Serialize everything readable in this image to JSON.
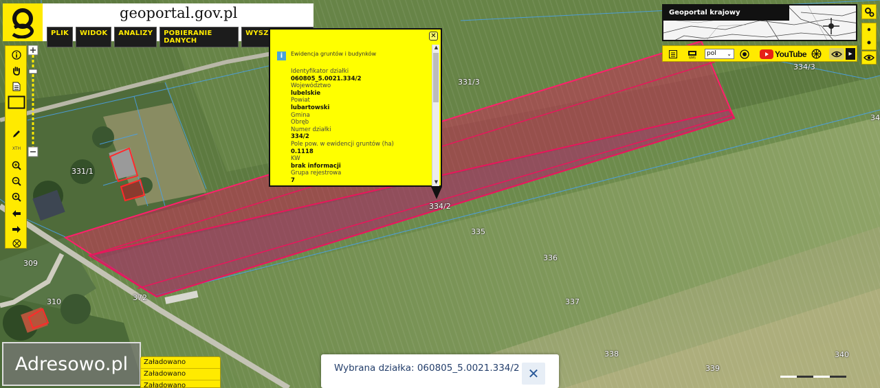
{
  "header": {
    "site_title": "geoportal.gov.pl",
    "menu": [
      "PLIK",
      "WIDOK",
      "ANALIZY",
      "POBIERANIE DANYCH",
      "WYSZUKIWANIA"
    ]
  },
  "toolbar": {
    "scale_label": "XTH"
  },
  "popup": {
    "header": "Ewidencja gruntów i budynków",
    "close_glyph": "✕",
    "attributes": [
      {
        "label": "Identyfikator działki",
        "value": "060805_5.0021.334/2"
      },
      {
        "label": "Województwo",
        "value": "lubelskie"
      },
      {
        "label": "Powiat",
        "value": "lubartowski"
      },
      {
        "label": "Gmina",
        "value": ""
      },
      {
        "label": "Obręb",
        "value": ""
      },
      {
        "label": "Numer działki",
        "value": "334/2"
      },
      {
        "label": "Pole pow. w ewidencji gruntów (ha)",
        "value": "0.1118"
      },
      {
        "label": "KW",
        "value": "brak informacji"
      },
      {
        "label": "Grupa rejestrowa",
        "value": "7"
      }
    ]
  },
  "overview": {
    "title": "Geoportal krajowy"
  },
  "right_toolbar": {
    "language": "pol",
    "youtube_label": "YouTube"
  },
  "map": {
    "parcel_labels": [
      "331/3",
      "331/1",
      "334/3",
      "334/2",
      "335",
      "336",
      "337",
      "338",
      "339",
      "340",
      "309",
      "310",
      "372",
      "34"
    ],
    "highlight_color": "#e8165c"
  },
  "watermark": {
    "text": "Adresowo.pl"
  },
  "status_panel": {
    "rows": [
      "Załadowano",
      "Załadowano",
      "Załadowano"
    ]
  },
  "selected_parcel": {
    "text": "Wybrana działka: 060805_5.0021.334/2",
    "close_glyph": "✕"
  }
}
